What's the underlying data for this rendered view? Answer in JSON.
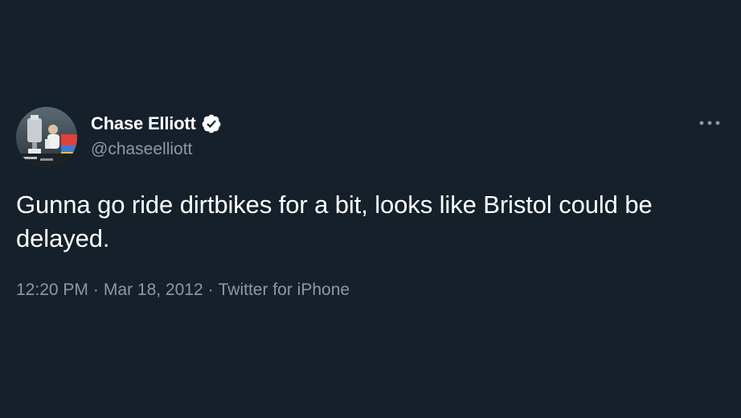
{
  "tweet": {
    "author": {
      "display_name": "Chase Elliott",
      "handle": "@chaseelliott",
      "verified": true,
      "avatar_icon": "trophy-celebration-avatar"
    },
    "text": "Gunna go ride dirtbikes for a bit, looks like Bristol could be delayed.",
    "time": "12:20 PM",
    "separator": "·",
    "date": "Mar 18, 2012",
    "source": "Twitter for iPhone",
    "more_icon": "more-options-icon"
  },
  "colors": {
    "background": "#15202b",
    "primary_text": "#ffffff",
    "secondary_text": "#8b98a5",
    "verified_badge": "#ffffff"
  }
}
